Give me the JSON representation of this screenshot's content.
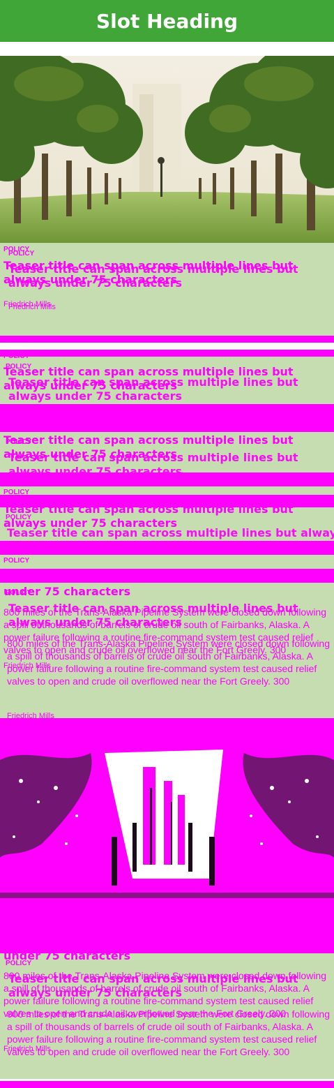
{
  "page": {
    "heading": "Slot Heading"
  },
  "colors": {
    "brand_green": "#3fa637",
    "card_green": "#c5ddb0",
    "placeholder_magenta": "#ff00ff"
  },
  "teaser": {
    "category": "POLICY",
    "title": "Teaser title can span across multiple lines but always under 75 characters",
    "title_line1": "Teaser title can span across multiple lines but always",
    "title_line2": "under 75 characters",
    "author": "Friedrich Mills",
    "body": "800 miles of the Trans-Alaska Pipeline System were closed down following a spill of thousands of barrels of crude oil south of Fairbanks, Alaska. A power failure following a routine fire-command system test caused relief valves to open and crude oil overflowed near the Fort Greely. 300"
  },
  "images": {
    "hero": "palm-avenue-photo",
    "second": "palm-avenue-photo-posterized"
  }
}
